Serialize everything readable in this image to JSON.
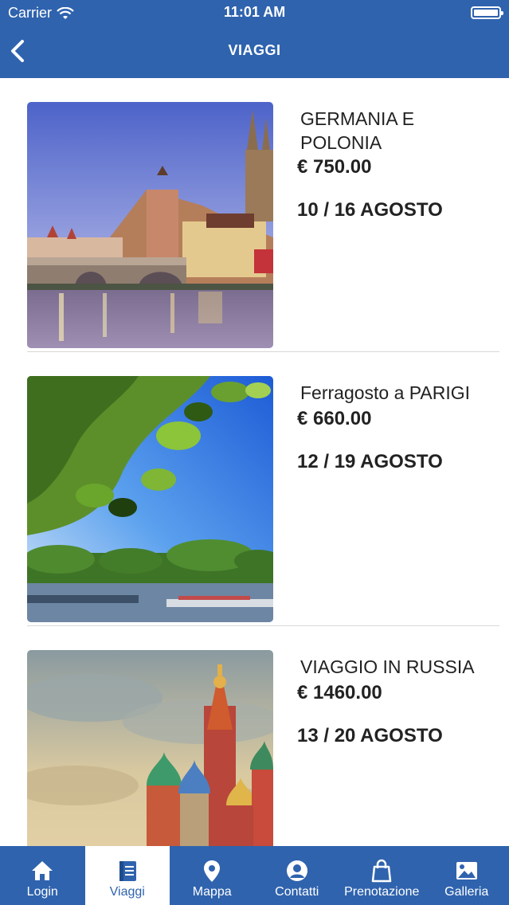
{
  "status_bar": {
    "carrier": "Carrier",
    "time": "11:01 AM"
  },
  "nav": {
    "title": "VIAGGI"
  },
  "trips": [
    {
      "title": "GERMANIA E POLONIA",
      "price": "€ 750.00",
      "dates": "10 / 16 AGOSTO"
    },
    {
      "title": "Ferragosto a PARIGI",
      "price": "€ 660.00",
      "dates": "12 / 19 AGOSTO"
    },
    {
      "title": "VIAGGIO IN RUSSIA",
      "price": "€ 1460.00",
      "dates": "13 / 20 AGOSTO"
    }
  ],
  "tabbar": {
    "active": "Viaggi",
    "items": [
      {
        "label": "Login",
        "icon": "home-icon"
      },
      {
        "label": "Viaggi",
        "icon": "book-icon"
      },
      {
        "label": "Mappa",
        "icon": "map-pin-icon"
      },
      {
        "label": "Contatti",
        "icon": "contact-icon"
      },
      {
        "label": "Prenotazione",
        "icon": "shopping-bag-icon"
      },
      {
        "label": "Galleria",
        "icon": "image-icon"
      }
    ]
  },
  "colors": {
    "primary": "#2f63ae",
    "text": "#222222",
    "background": "#ffffff"
  }
}
